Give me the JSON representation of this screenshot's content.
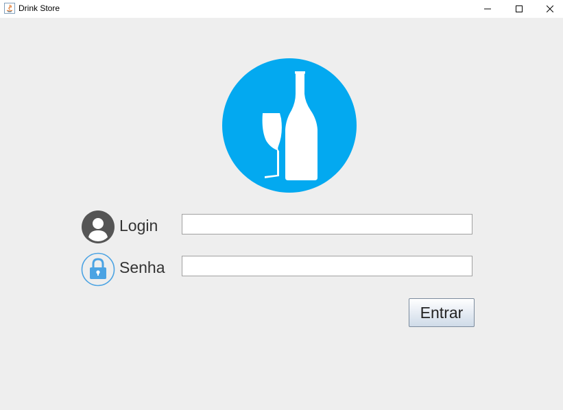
{
  "window": {
    "title": "Drink Store",
    "controls": {
      "minimize_icon": "minimize-icon",
      "maximize_icon": "maximize-icon",
      "close_icon": "close-icon"
    }
  },
  "logo": {
    "icon": "bottle-glass-icon",
    "color": "#03a9f0"
  },
  "form": {
    "login": {
      "label": "Login",
      "icon": "user-icon",
      "value": "",
      "placeholder": ""
    },
    "password": {
      "label": "Senha",
      "icon": "lock-icon",
      "value": "",
      "placeholder": ""
    },
    "submit_label": "Entrar"
  },
  "colors": {
    "background": "#eeeeee",
    "accent": "#03a9f0",
    "lock_blue": "#4ba3e3",
    "user_gray": "#555555"
  }
}
